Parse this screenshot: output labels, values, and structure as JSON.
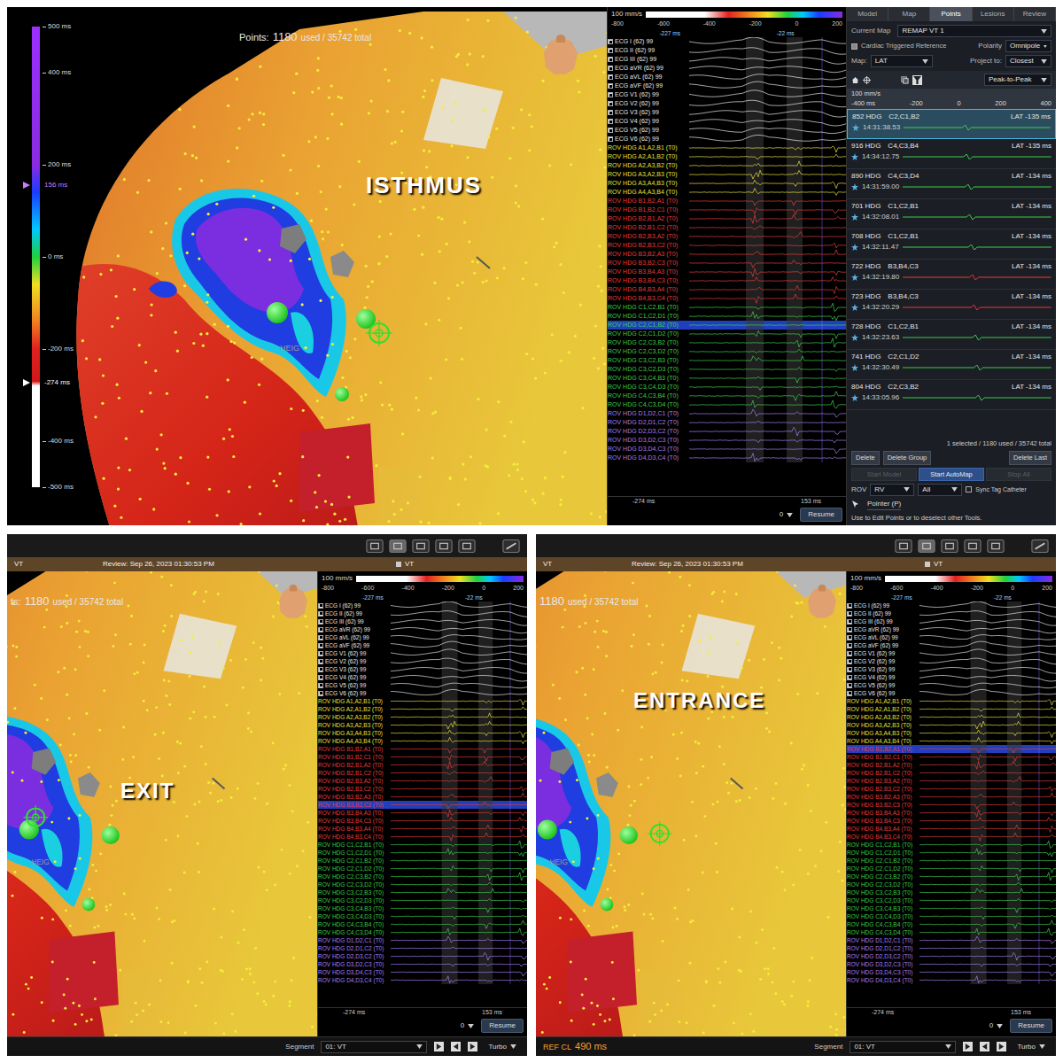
{
  "main_view": {
    "points": {
      "label": "Points:",
      "used": "1180",
      "rest": "used / 35742 total"
    },
    "map_label": "ISTHMUS",
    "tag": "HEIG",
    "colorbar": {
      "ticks": [
        "500 ms",
        "400 ms",
        "200 ms",
        "0 ms",
        "-200 ms",
        "-400 ms",
        "-500 ms"
      ],
      "markers": [
        {
          "label": "156 ms",
          "color": "#c77dff"
        },
        {
          "label": "-274 ms",
          "color": "#ffffff"
        }
      ]
    },
    "highlighted_channel": "ROV HDG C2,C1,B2 (T0)"
  },
  "waveform": {
    "scale": "100 mm/s",
    "axis": [
      "-800",
      "-600",
      "-400",
      "-200",
      "0",
      "200"
    ],
    "markers": [
      "-227 ms",
      "-22 ms"
    ],
    "footer_marks": [
      "-274 ms",
      "153 ms"
    ],
    "segment_value": "0",
    "resume": "Resume",
    "ecg": [
      {
        "label": "ECG I (62) 99",
        "checked": true
      },
      {
        "label": "ECG II (62) 99",
        "checked": true
      },
      {
        "label": "ECG III (62) 99",
        "checked": true
      },
      {
        "label": "ECG aVR (62) 99",
        "checked": true
      },
      {
        "label": "ECG aVL (62) 99",
        "checked": true
      },
      {
        "label": "ECG aVF (62) 99",
        "checked": true
      },
      {
        "label": "ECG V1 (62) 99",
        "checked": true
      },
      {
        "label": "ECG V2 (62) 99",
        "checked": true
      },
      {
        "label": "ECG V3 (62) 99",
        "checked": true
      },
      {
        "label": "ECG V4 (62) 99",
        "checked": true
      },
      {
        "label": "ECG V5 (62) 99",
        "checked": true
      },
      {
        "label": "ECG V6 (62) 99",
        "checked": true
      }
    ],
    "groups": [
      {
        "color": "#e8e03a",
        "channels": [
          "ROV HDG A1,A2,B1 (T0)",
          "ROV HDG A2,A1,B2 (T0)",
          "ROV HDG A2,A3,B2 (T0)",
          "ROV HDG A3,A2,B3 (T0)",
          "ROV HDG A3,A4,B3 (T0)",
          "ROV HDG A4,A3,B4 (T0)"
        ]
      },
      {
        "color": "#e83a3a",
        "channels": [
          "ROV HDG B1,B2,A1 (T0)",
          "ROV HDG B1,B2,C1 (T0)",
          "ROV HDG B2,B1,A2 (T0)",
          "ROV HDG B2,B1,C2 (T0)",
          "ROV HDG B2,B3,A2 (T0)",
          "ROV HDG B2,B3,C2 (T0)",
          "ROV HDG B3,B2,A3 (T0)",
          "ROV HDG B3,B2,C3 (T0)",
          "ROV HDG B3,B4,A3 (T0)",
          "ROV HDG B3,B4,C3 (T0)",
          "ROV HDG B4,B3,A4 (T0)",
          "ROV HDG B4,B3,C4 (T0)"
        ]
      },
      {
        "color": "#3ccf4a",
        "channels": [
          "ROV HDG C1,C2,B1 (T0)",
          "ROV HDG C1,C2,D1 (T0)",
          "ROV HDG C2,C1,B2 (T0)",
          "ROV HDG C2,C1,D2 (T0)",
          "ROV HDG C2,C3,B2 (T0)",
          "ROV HDG C2,C3,D2 (T0)",
          "ROV HDG C3,C2,B3 (T0)",
          "ROV HDG C3,C2,D3 (T0)",
          "ROV HDG C3,C4,B3 (T0)",
          "ROV HDG C3,C4,D3 (T0)",
          "ROV HDG C4,C3,B4 (T0)",
          "ROV HDG C4,C3,D4 (T0)"
        ]
      },
      {
        "color": "#a57cf0",
        "channels": [
          "ROV HDG D1,D2,C1 (T0)",
          "ROV HDG D2,D1,C2 (T0)",
          "ROV HDG D2,D3,C2 (T0)",
          "ROV HDG D3,D2,C3 (T0)",
          "ROV HDG D3,D4,C3 (T0)",
          "ROV HDG D4,D3,C4 (T0)"
        ]
      }
    ]
  },
  "sidebar": {
    "tabs": [
      {
        "label": "Model",
        "selected": false
      },
      {
        "label": "Map",
        "selected": false
      },
      {
        "label": "Points",
        "selected": true
      },
      {
        "label": "Lesions",
        "selected": false
      },
      {
        "label": "Review",
        "selected": false
      }
    ],
    "current_map": {
      "label": "Current Map",
      "value": "REMAP VT 1"
    },
    "cardiac_ref": {
      "label": "Cardiac Triggered Reference",
      "checked": true
    },
    "polarity": {
      "label": "Polarity",
      "value": "Omnipole"
    },
    "map": {
      "label": "Map:",
      "value": "LAT"
    },
    "project": {
      "label": "Project to:",
      "value": "Closest"
    },
    "measure": "Peak-to-Peak",
    "ruler": {
      "scale": "100 mm/s",
      "ticks": [
        "-400 ms",
        "-200",
        "0",
        "200",
        "400"
      ]
    },
    "points": [
      {
        "id": "852 HDG",
        "electrodes": "C2,C1,B2",
        "lat": "LAT -135 ms",
        "time": "14:31:38.53",
        "color": "#3ccf4a",
        "selected": true
      },
      {
        "id": "916 HDG",
        "electrodes": "C4,C3,B4",
        "lat": "LAT -135 ms",
        "time": "14:34:12.75",
        "color": "#3ccf4a",
        "selected": false
      },
      {
        "id": "890 HDG",
        "electrodes": "C4,C3,D4",
        "lat": "LAT -134 ms",
        "time": "14:31:59.00",
        "color": "#3ccf4a",
        "selected": false
      },
      {
        "id": "701 HDG",
        "electrodes": "C1,C2,B1",
        "lat": "LAT -134 ms",
        "time": "14:32:08.01",
        "color": "#3ccf4a",
        "selected": false
      },
      {
        "id": "708 HDG",
        "electrodes": "C1,C2,B1",
        "lat": "LAT -134 ms",
        "time": "14:32:11.47",
        "color": "#3ccf4a",
        "selected": false
      },
      {
        "id": "722 HDG",
        "electrodes": "B3,B4,C3",
        "lat": "LAT -134 ms",
        "time": "14:32:19.80",
        "color": "#e83a3a",
        "selected": false
      },
      {
        "id": "723 HDG",
        "electrodes": "B3,B4,C3",
        "lat": "LAT -134 ms",
        "time": "14:32:20.29",
        "color": "#e83a3a",
        "selected": false
      },
      {
        "id": "728 HDG",
        "electrodes": "C1,C2,B1",
        "lat": "LAT -134 ms",
        "time": "14:32:23.63",
        "color": "#3ccf4a",
        "selected": false
      },
      {
        "id": "741 HDG",
        "electrodes": "C2,C1,D2",
        "lat": "LAT -134 ms",
        "time": "14:32:30.49",
        "color": "#3ccf4a",
        "selected": false
      },
      {
        "id": "804 HDG",
        "electrodes": "C2,C3,B2",
        "lat": "LAT -134 ms",
        "time": "14:33:05.96",
        "color": "#3ccf4a",
        "selected": false
      }
    ],
    "summary": "1 selected / 1180 used / 35742 total",
    "buttons": [
      "Delete",
      "Delete Group",
      "Delete Last"
    ],
    "map_buttons": [
      {
        "label": "Start Model",
        "disabled": true
      },
      {
        "label": "Start AutoMap",
        "disabled": false
      },
      {
        "label": "Stop All",
        "disabled": true
      }
    ],
    "rov": {
      "label": "ROV",
      "value": "RV",
      "filter": "All"
    },
    "sync": {
      "label": "Sync Tag Catheter",
      "checked": false
    },
    "tool": {
      "label": "Pointer (P)",
      "hint": "Use to Edit Points or to deselect other Tools."
    }
  },
  "sub_views": [
    {
      "title_left": "VT",
      "review": "Review: Sep 26, 2023 01:30:53 PM",
      "title_right": "VT",
      "points": {
        "label": "ts:",
        "used": "1180",
        "rest": "used / 35742 total"
      },
      "map_label": "EXIT",
      "tag": "HEIG",
      "highlighted_channel": "ROV HDG B3,B2,C3 (T0)",
      "segment": {
        "label": "Segment",
        "value": "01: VT",
        "mode": "Turbo"
      },
      "ref_cl": null
    },
    {
      "title_left": "VT",
      "review": "Review: Sep 26, 2023 01:30:53 PM",
      "title_right": "VT",
      "points": {
        "label": "",
        "used": "1180",
        "rest": "used / 35742 total"
      },
      "map_label": "ENTRANCE",
      "tag": "HEIG",
      "highlighted_channel": "ROV HDG B1,B2,A1 (T0)",
      "segment": {
        "label": "Segment",
        "value": "01: VT",
        "mode": "Turbo"
      },
      "ref_cl": {
        "label": "REF CL",
        "value": "490 ms"
      }
    }
  ]
}
